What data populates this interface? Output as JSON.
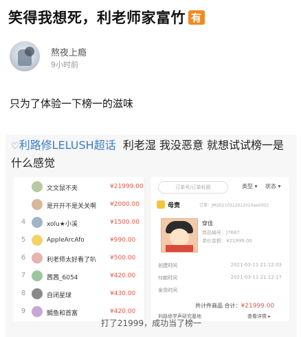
{
  "headline": {
    "text": "笑得我想死，利老师家富竹",
    "badge": "有"
  },
  "post": {
    "username": "熬夜上瘾",
    "time": "9小时前",
    "text": "只为了体验一下榜一的滋味"
  },
  "image": {
    "topic_icon": "♡",
    "topic": "利路修LELUSH超话",
    "caption": "利老湿 我没恶意 就想试试榜一是什么感觉",
    "subtitle": "打了21999，成功当了榜一",
    "ranking": [
      {
        "rank": "",
        "name": "文文鼠不夹",
        "amount": "¥21999.00",
        "avatar_color": "#b9c7a4"
      },
      {
        "rank": "",
        "name": "是开开不是关关啊",
        "amount": "¥2000.00",
        "avatar_color": "#d8b89a"
      },
      {
        "rank": "4",
        "name": "xolu★小溪",
        "amount": "¥1500.00",
        "avatar_color": "#9fb4c9"
      },
      {
        "rank": "5",
        "name": "AppleArcAfo",
        "amount": "¥990.00",
        "avatar_color": "#f2d36b"
      },
      {
        "rank": "6",
        "name": "利老师太好看了叭",
        "amount": "¥500.00",
        "avatar_color": "#e6b3b3"
      },
      {
        "rank": "7",
        "name": "茜茜_6054",
        "amount": "¥420.00",
        "avatar_color": "#9cc79e"
      },
      {
        "rank": "8",
        "name": "自闭星球",
        "amount": "¥430.00",
        "avatar_color": "#8a8a8a"
      },
      {
        "rank": "9",
        "name": "鲷鱼和首富",
        "amount": "¥420.00",
        "avatar_color": "#c7a7d6"
      }
    ],
    "order": {
      "search_placeholder": "订单号/订单标题",
      "filter_type": "类型",
      "filter_status": "状态",
      "shop_name": "母责",
      "order_id": "订单：JM20210312012010ae5002",
      "product_title": "穿佳",
      "product_sub1": "商品编号：J7667",
      "product_sub2": "单价金额：¥21999.00",
      "row1_label": "创建时间",
      "row1_value": "2021-03-11 21:12:03",
      "row2_label": "付款时间",
      "row2_value": "2021-03-11 21:12:17",
      "row3_label": "发货时间",
      "row3_value": "",
      "total_label": "共计件商品 合计：",
      "total_amount": "¥21999.00",
      "foot_label": "利路修学声研究基地",
      "foot_action": "查看详情 ▸"
    }
  }
}
